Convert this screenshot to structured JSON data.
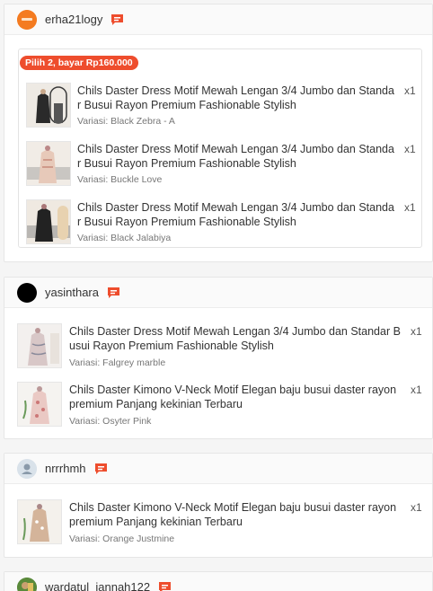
{
  "sellers": [
    {
      "username": "erha21logy",
      "avatar_color": "#f47b20",
      "promo_badge": "Pilih 2, bayar Rp160.000",
      "items": [
        {
          "name": "Chils Daster Dress Motif Mewah Lengan 3/4 Jumbo dan Standa r Busui Rayon Premium Fashionable Stylish",
          "variant": "Variasi: Black Zebra - A",
          "qty": "x1"
        },
        {
          "name": "Chils Daster Dress Motif Mewah Lengan 3/4 Jumbo dan Standa r Busui Rayon Premium Fashionable Stylish",
          "variant": "Variasi: Buckle Love",
          "qty": "x1"
        },
        {
          "name": "Chils Daster Dress Motif Mewah Lengan 3/4 Jumbo dan Standa r Busui Rayon Premium Fashionable Stylish",
          "variant": "Variasi: Black Jalabiya",
          "qty": "x1"
        }
      ]
    },
    {
      "username": "yasinthara",
      "avatar_color": "#000000",
      "items": [
        {
          "name": "Chils Daster Dress Motif Mewah Lengan 3/4 Jumbo dan Standar B usui Rayon Premium Fashionable Stylish",
          "variant": "Variasi: Falgrey marble",
          "qty": "x1"
        },
        {
          "name": "Chils Daster Kimono V-Neck Motif Elegan baju busui daster rayon premium Panjang kekinian Terbaru",
          "variant": "Variasi: Osyter Pink",
          "qty": "x1"
        }
      ]
    },
    {
      "username": "nrrrhmh",
      "avatar_color": "#d9e2ea",
      "items": [
        {
          "name": "Chils Daster Kimono V-Neck Motif Elegan baju busui daster rayon premium Panjang kekinian Terbaru",
          "variant": "Variasi: Orange Justmine",
          "qty": "x1"
        }
      ]
    },
    {
      "username": "wardatul_jannah122",
      "avatar_color": "#4a7a3a",
      "items": []
    }
  ],
  "colors": {
    "accent": "#ee4d2d",
    "chat_icon": "#ee4d2d"
  },
  "icons": {
    "chat": "chat-bubble-icon",
    "default_avatar": "user-icon"
  }
}
